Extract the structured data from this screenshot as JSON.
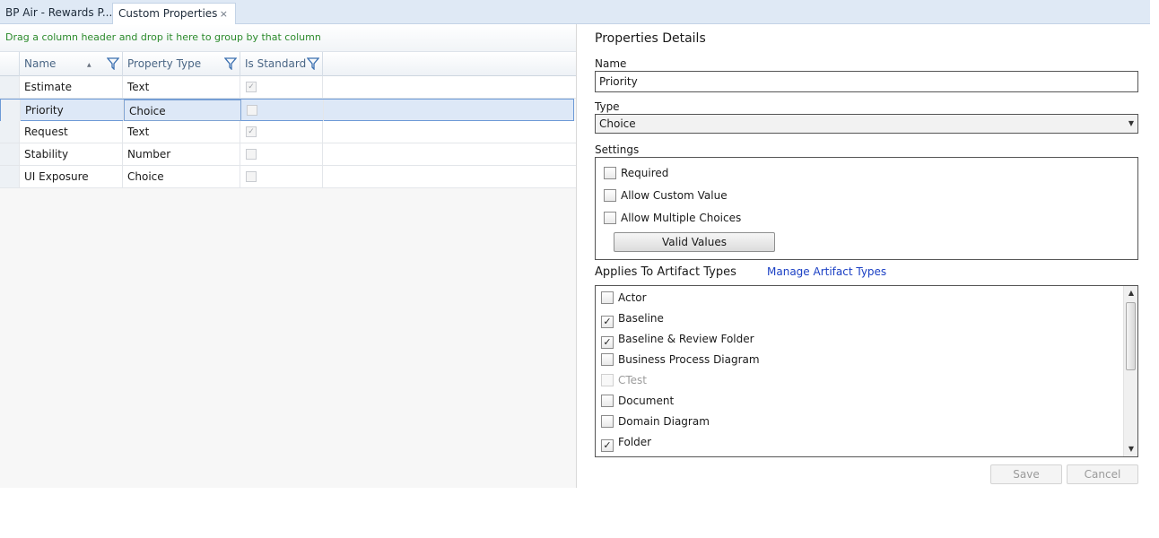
{
  "tabs": [
    {
      "label": "BP Air - Rewards P..."
    },
    {
      "label": "Custom Properties",
      "close": "×"
    }
  ],
  "grid": {
    "group_hint": "Drag a column header and drop it here to group by that column",
    "columns": [
      "Name",
      "Property Type",
      "Is Standard"
    ],
    "rows": [
      {
        "name": "Estimate",
        "type": "Text",
        "is_standard": true,
        "mark": "✓"
      },
      {
        "name": "Priority",
        "type": "Choice",
        "is_standard": false,
        "mark": ""
      },
      {
        "name": "Request",
        "type": "Text",
        "is_standard": true,
        "mark": "✓"
      },
      {
        "name": "Stability",
        "type": "Number",
        "is_standard": false,
        "mark": ""
      },
      {
        "name": "UI Exposure",
        "type": "Choice",
        "is_standard": false,
        "mark": ""
      }
    ],
    "selected_row": "Priority"
  },
  "details": {
    "title": "Properties Details",
    "name_label": "Name",
    "name_value": "Priority",
    "type_label": "Type",
    "type_value": "Choice",
    "settings_label": "Settings",
    "settings": [
      {
        "label": "Required",
        "checked": false
      },
      {
        "label": "Allow Custom Value",
        "checked": false
      },
      {
        "label": "Allow Multiple Choices",
        "checked": false
      }
    ],
    "valid_values_button": "Valid Values",
    "applies_label": "Applies To Artifact Types",
    "manage_link": "Manage Artifact Types",
    "artifact_types": [
      {
        "label": "Actor",
        "mark": ""
      },
      {
        "label": "Baseline",
        "mark": "✓"
      },
      {
        "label": "Baseline & Review Folder",
        "mark": "✓"
      },
      {
        "label": "Business Process Diagram",
        "mark": ""
      },
      {
        "label": "CTest",
        "mark": ""
      },
      {
        "label": "Document",
        "mark": ""
      },
      {
        "label": "Domain Diagram",
        "mark": ""
      },
      {
        "label": "Folder",
        "mark": "✓"
      }
    ],
    "save_button": "Save",
    "cancel_button": "Cancel"
  },
  "colors": {
    "tab_strip": "#dfe9f5",
    "group_hint_text": "#2b8a2b",
    "selected_row": "#dde8f7",
    "link": "#1a3fc4"
  }
}
